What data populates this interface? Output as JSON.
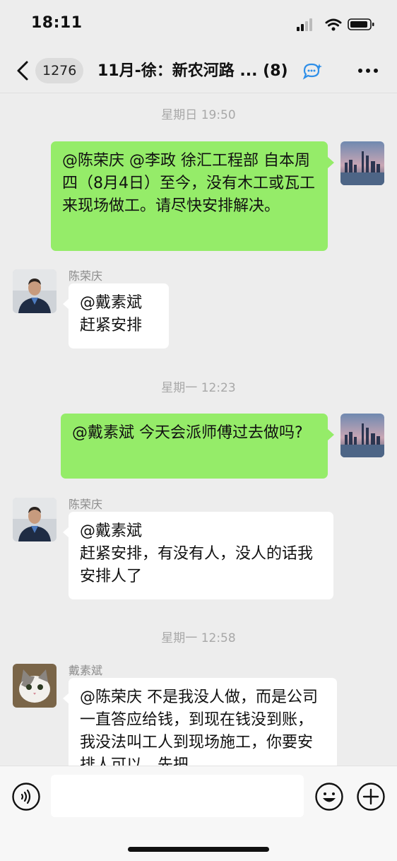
{
  "status_bar": {
    "time": "18:11"
  },
  "nav": {
    "unread_count": "1276",
    "title": "11月-徐：新农河路 ...",
    "member_count": "(8)"
  },
  "messages": [
    {
      "type": "timestamp",
      "text": "星期日 19:50"
    },
    {
      "type": "outgoing",
      "text": "@陈荣庆 @李政 徐汇工程部 自本周四（8月4日）至今，没有木工或瓦工来现场做工。请尽快安排解决。"
    },
    {
      "type": "incoming",
      "sender": "陈荣庆",
      "text": "@戴素斌\n赶紧安排"
    },
    {
      "type": "timestamp",
      "text": "星期一 12:23"
    },
    {
      "type": "outgoing",
      "text": "@戴素斌 今天会派师傅过去做吗?"
    },
    {
      "type": "incoming",
      "sender": "陈荣庆",
      "text": "@戴素斌\n赶紧安排，有没有人，没人的话我安排人了"
    },
    {
      "type": "timestamp",
      "text": "星期一 12:58"
    },
    {
      "type": "incoming",
      "sender": "戴素斌",
      "text": "@陈荣庆 不是我没人做，而是公司一直答应给钱，到现在钱没到账，我没法叫工人到现场施工，你要安排人可以，先把"
    }
  ],
  "colors": {
    "outgoing_bubble": "#95ec69",
    "incoming_bubble": "#ffffff",
    "background": "#ededed",
    "group_icon_accent": "#2f8fe8"
  },
  "icons": {
    "back": "chevron-left-icon",
    "group": "group-chat-icon",
    "more": "more-dots-icon",
    "voice": "voice-icon",
    "emoji": "emoji-icon",
    "plus": "plus-icon"
  }
}
